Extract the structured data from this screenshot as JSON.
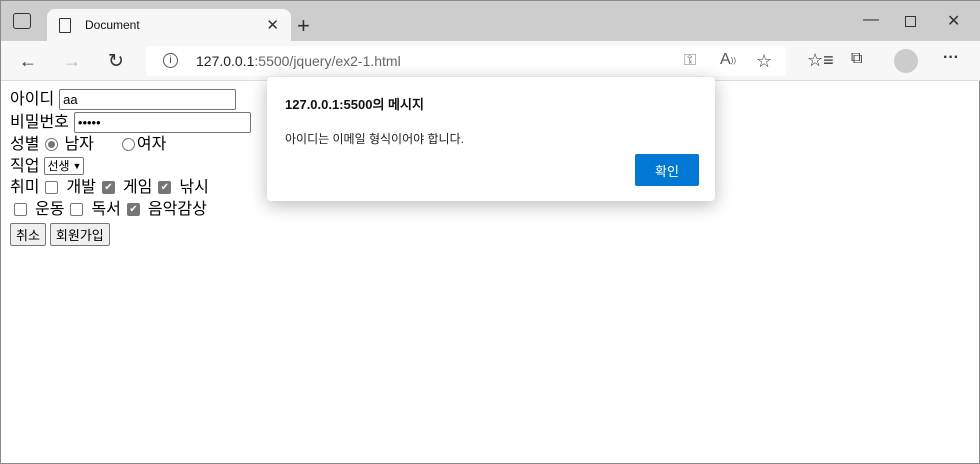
{
  "browser": {
    "tab_title": "Document",
    "url_host": "127.0.0.1",
    "url_rest": ":5500/jquery/ex2-1.html"
  },
  "form": {
    "id_label": "아이디",
    "id_value": "aa",
    "pw_label": "비밀번호",
    "pw_value": "•••••",
    "gender_label": "성별",
    "gender_male": "남자",
    "gender_female": "여자",
    "job_label": "직업",
    "job_value": "선생",
    "hobby_label": "취미",
    "hobbies": [
      {
        "label": "개발",
        "checked": false
      },
      {
        "label": "게임",
        "checked": true
      },
      {
        "label": "낚시",
        "checked": true
      },
      {
        "label": "운동",
        "checked": false
      },
      {
        "label": "독서",
        "checked": false
      },
      {
        "label": "음악감상",
        "checked": true
      }
    ],
    "cancel": "취소",
    "signup": "회원가입"
  },
  "dialog": {
    "title": "127.0.0.1:5500의 메시지",
    "message": "아이디는 이메일 형식이어야 합니다.",
    "ok": "확인",
    "accent": "#0078d4"
  }
}
